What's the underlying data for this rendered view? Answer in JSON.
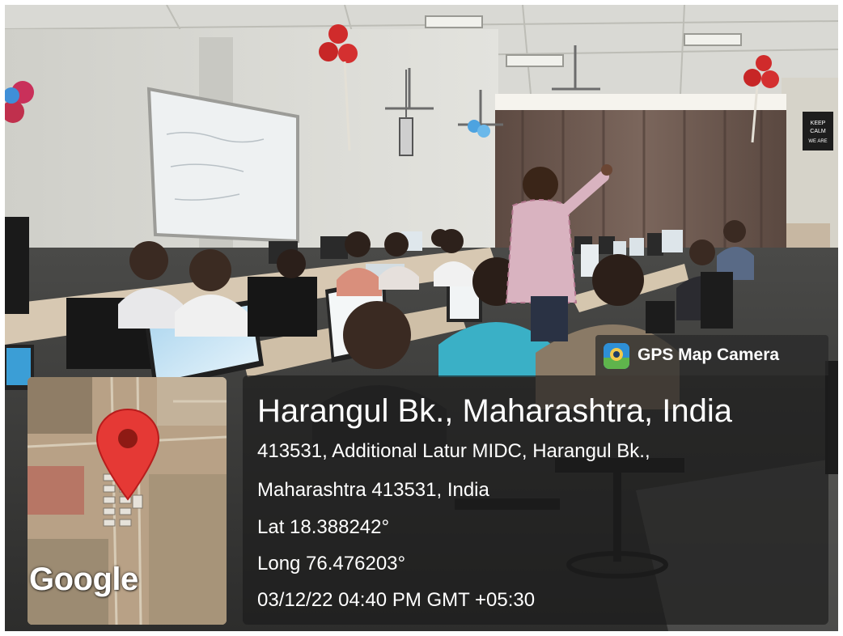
{
  "overlay": {
    "app_name": "GPS Map Camera",
    "map_logo_text": "Google",
    "place_title": "Harangul Bk., Maharashtra, India",
    "address_line_1": "413531, Additional Latur MIDC, Harangul Bk.,",
    "address_line_2": "Maharashtra 413531, India",
    "latitude": "Lat 18.388242°",
    "longitude": "Long 76.476203°",
    "datetime": "03/12/22 04:40 PM GMT +05:30"
  },
  "wall_sign": {
    "lines": [
      "KEEP",
      "CALM",
      "WE ARE"
    ]
  },
  "colors": {
    "map_pin": "#e53935",
    "app_icon": "#2e8fd6",
    "overlay_panel": "#1c1c1c"
  },
  "icons": [
    "map-pin-icon",
    "gps-map-camera-icon"
  ]
}
